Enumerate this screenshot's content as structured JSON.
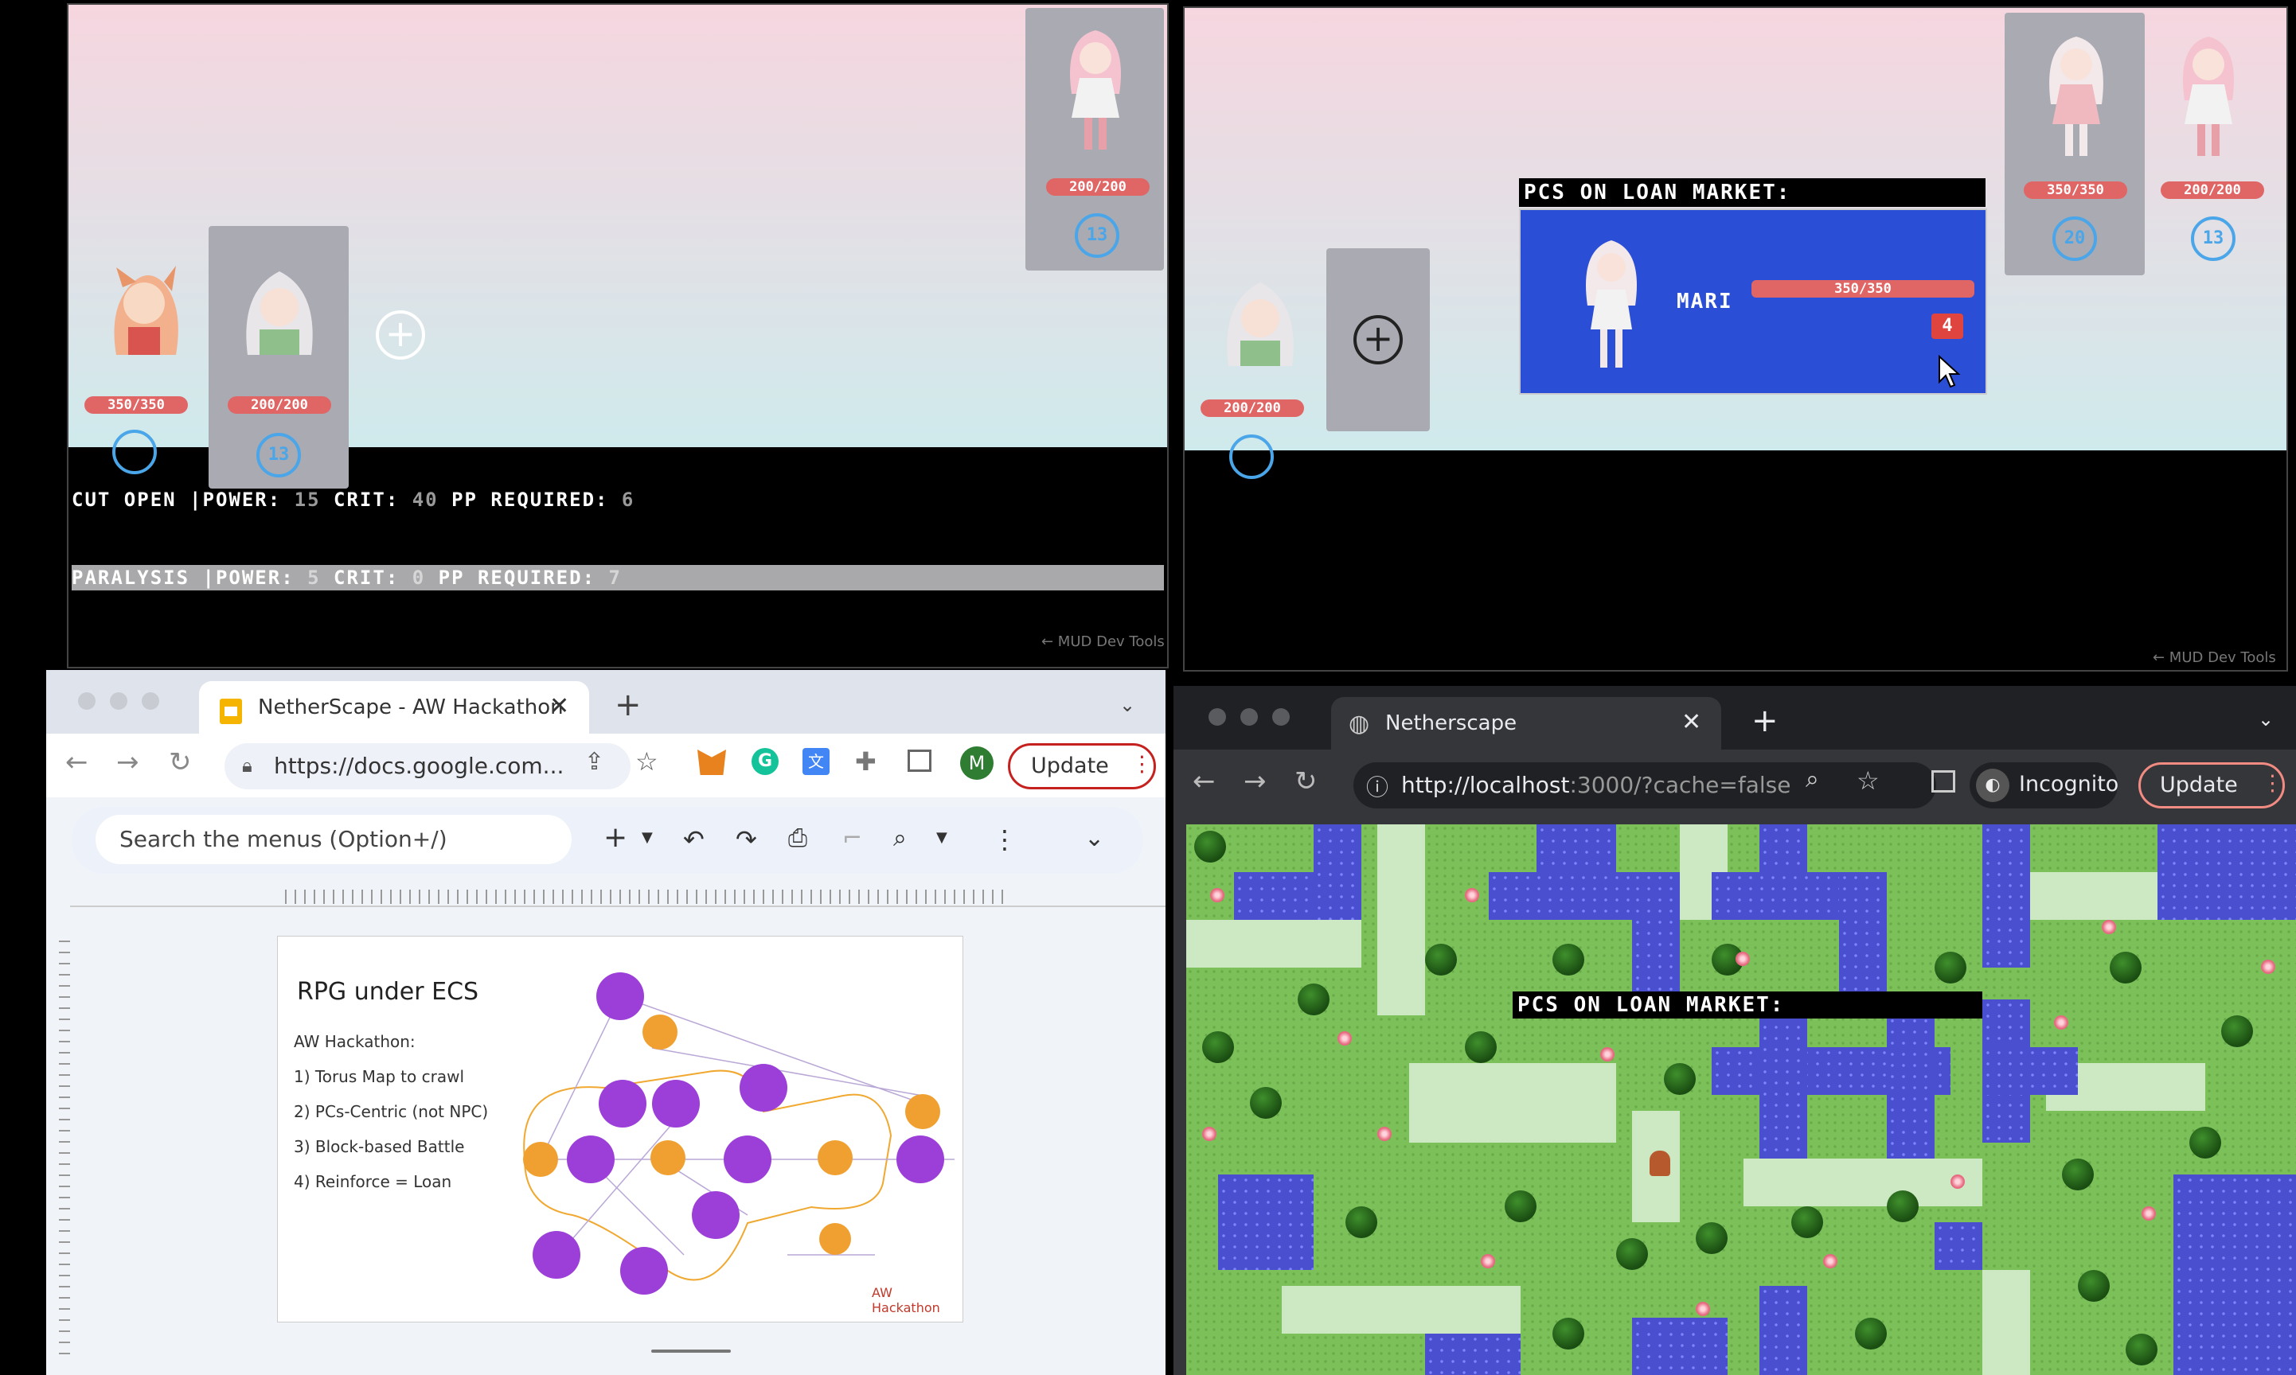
{
  "game_left": {
    "party": [
      {
        "hp": "350/350"
      },
      {
        "hp": "200/200",
        "level": "13"
      }
    ],
    "enemy": {
      "hp": "200/200",
      "level": "13"
    },
    "skills": [
      {
        "name": "CUT OPEN",
        "power_label": "|POWER:",
        "power": "15",
        "crit_label": "CRIT:",
        "crit": "40",
        "pp_label": "PP REQUIRED:",
        "pp": "6"
      },
      {
        "name": "PARALYSIS",
        "power_label": "|POWER:",
        "power": "5",
        "crit_label": "CRIT:",
        "crit": "0",
        "pp_label": "PP REQUIRED:",
        "pp": "7"
      }
    ],
    "devtools": "← MUD Dev Tools"
  },
  "game_right": {
    "party": [
      {
        "hp": "200/200"
      }
    ],
    "market_title": "PCS ON LOAN MARKET:",
    "loan_card": {
      "name": "MARI",
      "hp": "350/350",
      "level": "4"
    },
    "enemies": [
      {
        "hp": "350/350",
        "level": "20"
      },
      {
        "hp": "200/200",
        "level": "13"
      }
    ],
    "devtools": "← MUD Dev Tools"
  },
  "browser_docs": {
    "tab_title": "NetherScape - AW Hackathon",
    "url": "https://docs.google.com...",
    "avatar_letter": "M",
    "update_label": "Update",
    "search_placeholder": "Search the menus (Option+/)",
    "slide": {
      "title": "RPG under ECS",
      "lines": [
        "AW Hackathon:",
        "1) Torus Map to crawl",
        "2) PCs-Centric (not NPC)",
        "3) Block-based Battle",
        "4) Reinforce = Loan"
      ],
      "footer": "AW Hackathon"
    }
  },
  "browser_game": {
    "tab_title": "Netherscape",
    "url_host": "http://localhost",
    "url_rest": ":3000/?cache=false",
    "incognito_label": "Incognito",
    "update_label": "Update",
    "market_title": "PCS ON LOAN MARKET:"
  },
  "colors": {
    "hp_bar": "#e06666",
    "level_ring": "#4aa6e8",
    "loan_card_bg": "#2a4fd6",
    "water": "#4a4fd0",
    "grass": "#7cc05a"
  }
}
